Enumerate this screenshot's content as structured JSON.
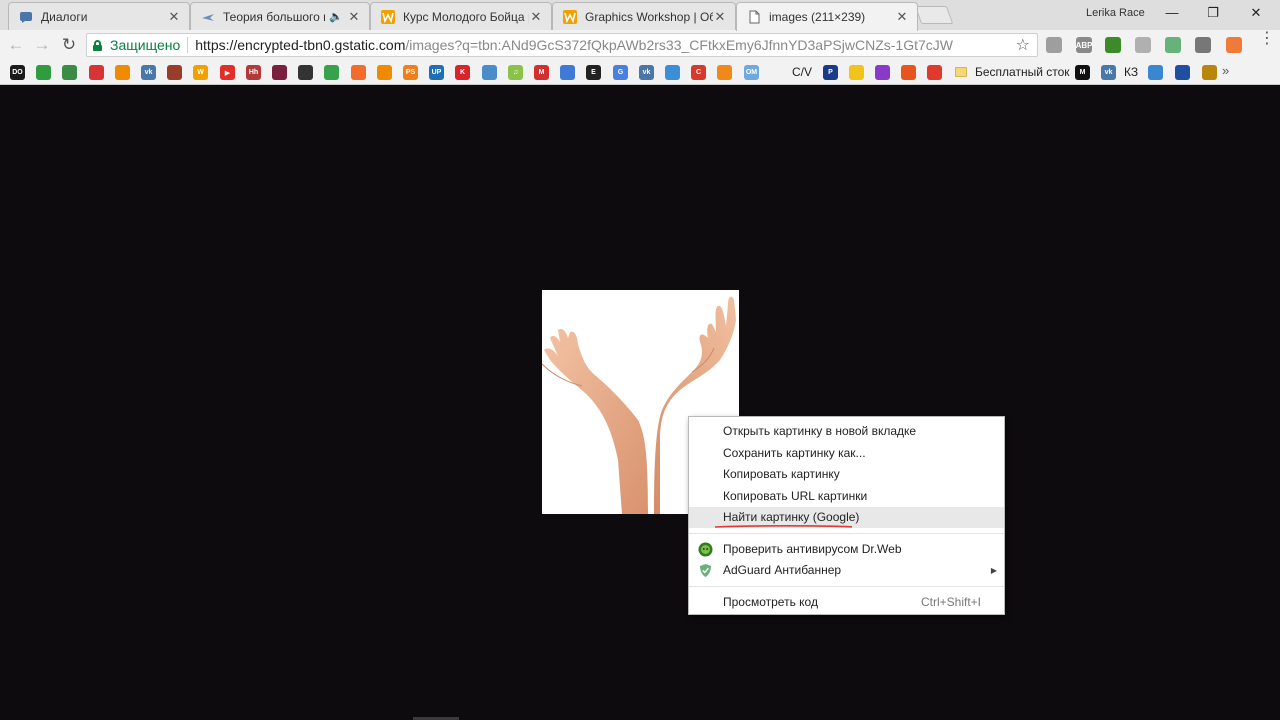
{
  "tabs": [
    {
      "title": "Диалоги",
      "icon": "vk-messages-icon"
    },
    {
      "title": "Теория большого вз",
      "icon": "plane-icon",
      "audio": "🔈"
    },
    {
      "title": "Курс Молодого Бойца |",
      "icon": "w-icon"
    },
    {
      "title": "Graphics Workshop | Об",
      "icon": "w-icon"
    },
    {
      "title": "images (211×239)",
      "icon": "page-icon"
    }
  ],
  "profile_name": "Lerika Race",
  "address": {
    "secure_label": "Защищено",
    "url_host": "https://encrypted-tbn0.gstatic.com",
    "url_path": "/images?q=tbn:ANd9GcS372fQkpAWb2rs33_CFtkxEmy6JfnnYD3aPSjwCNZs-1Gt7cJW"
  },
  "extensions": [
    {
      "name": "extension-icon",
      "label": "",
      "color": "#9e9e9e"
    },
    {
      "name": "adblock-icon",
      "label": "ABP",
      "color": "#8a8a8a"
    },
    {
      "name": "drweb-icon",
      "label": "",
      "color": "#3c8a28"
    },
    {
      "name": "cloud-icon",
      "label": "",
      "color": "#b0b0b0"
    },
    {
      "name": "adguard-icon",
      "label": "",
      "color": "#67b279"
    },
    {
      "name": "dropper-icon",
      "label": "",
      "color": "#777777"
    },
    {
      "name": "photo-icon",
      "label": "",
      "color": "#f07a3a"
    }
  ],
  "bookmarks": {
    "icons": [
      {
        "name": "odnoklassniki-bookmark-icon",
        "label": "DO",
        "color": "#1b1b1b"
      },
      {
        "name": "green-circle-bookmark-icon",
        "label": "",
        "color": "#2e9c3f"
      },
      {
        "name": "turtle-bookmark-icon",
        "label": "",
        "color": "#3a8c46"
      },
      {
        "name": "red-circle-bookmark-icon",
        "label": "",
        "color": "#d93434"
      },
      {
        "name": "orange-square-bookmark-icon",
        "label": "",
        "color": "#f08a00"
      },
      {
        "name": "vk-bookmark-icon",
        "label": "vk",
        "color": "#4a76a8"
      },
      {
        "name": "feather-bookmark-icon",
        "label": "",
        "color": "#9a3c2a"
      },
      {
        "name": "w-bookmark-icon",
        "label": "W",
        "color": "#f0a000"
      },
      {
        "name": "youtube-bookmark-icon",
        "label": "▶",
        "color": "#e52d27"
      },
      {
        "name": "hh-bookmark-icon",
        "label": "Hh",
        "color": "#b33a3a"
      },
      {
        "name": "film-bookmark-icon",
        "label": "",
        "color": "#7a1f3d"
      },
      {
        "name": "shield-bookmark-icon",
        "label": "",
        "color": "#333333"
      },
      {
        "name": "lightning-bookmark-icon",
        "label": "",
        "color": "#36a34a"
      },
      {
        "name": "orange-dot-bookmark-icon",
        "label": "",
        "color": "#f26c2a"
      },
      {
        "name": "reel-bookmark-icon",
        "label": "",
        "color": "#f08a00"
      },
      {
        "name": "ps-bookmark-icon",
        "label": "PS",
        "color": "#f07e1b"
      },
      {
        "name": "up-bookmark-icon",
        "label": "UP",
        "color": "#1f6fb5"
      },
      {
        "name": "k-bookmark-icon",
        "label": "K",
        "color": "#d9252a"
      },
      {
        "name": "bird-bookmark-icon",
        "label": "",
        "color": "#4a8ec9"
      },
      {
        "name": "music-bookmark-icon",
        "label": "♫",
        "color": "#8bc34a"
      },
      {
        "name": "m-red-bookmark-icon",
        "label": "M",
        "color": "#d32f2f"
      },
      {
        "name": "pinwheel-bookmark-icon",
        "label": "",
        "color": "#3f7ad6"
      },
      {
        "name": "e-bookmark-icon",
        "label": "E",
        "color": "#222222"
      },
      {
        "name": "translate-bookmark-icon",
        "label": "G",
        "color": "#4a7fe0"
      },
      {
        "name": "vk2-bookmark-icon",
        "label": "vk",
        "color": "#4a76a8"
      },
      {
        "name": "cloud-blue-bookmark-icon",
        "label": "",
        "color": "#3a8fd6"
      },
      {
        "name": "c-bookmark-icon",
        "label": "C",
        "color": "#d63a2a"
      },
      {
        "name": "flame-bookmark-icon",
        "label": "",
        "color": "#ef8a1a"
      },
      {
        "name": "om-bookmark-icon",
        "label": "ОМ",
        "color": "#6fa8dc"
      }
    ],
    "cv_label": "C/V",
    "icons2": [
      {
        "name": "p-bookmark-icon",
        "label": "P",
        "color": "#1a3a8a"
      },
      {
        "name": "yellow-bookmark-icon",
        "label": "",
        "color": "#f0c419"
      },
      {
        "name": "wheel-bookmark-icon",
        "label": "",
        "color": "#8a3ac9"
      },
      {
        "name": "fox-bookmark-icon",
        "label": "",
        "color": "#e8541d"
      },
      {
        "name": "red-square-bookmark-icon",
        "label": "",
        "color": "#e03a2f"
      }
    ],
    "folder_label": "Бесплатный сток",
    "icons3": [
      {
        "name": "m-black-bookmark-icon",
        "label": "M",
        "color": "#111111"
      },
      {
        "name": "vk3-bookmark-icon",
        "label": "vk",
        "color": "#4a76a8"
      }
    ],
    "k3_label": "КЗ",
    "icons4": [
      {
        "name": "chart-bookmark-icon",
        "label": "",
        "color": "#3a86d0"
      },
      {
        "name": "coin-bookmark-icon",
        "label": "",
        "color": "#1f4fa0"
      },
      {
        "name": "gift-bookmark-icon",
        "label": "",
        "color": "#b8860b"
      }
    ],
    "more": "»"
  },
  "image": {
    "alt": "two hands"
  },
  "context_menu": {
    "items": [
      {
        "label": "Открыть картинку в новой вкладке"
      },
      {
        "label": "Сохранить картинку как..."
      },
      {
        "label": "Копировать картинку"
      },
      {
        "label": "Копировать URL картинки"
      },
      {
        "label": "Найти картинку (Google)"
      }
    ],
    "drweb": "Проверить антивирусом Dr.Web",
    "adguard": "AdGuard Антибаннер",
    "inspect": "Просмотреть код",
    "inspect_shortcut": "Ctrl+Shift+I"
  },
  "colors": {
    "page_bg": "#0e0b0e",
    "underline": "#e53935",
    "secure": "#0b8043"
  }
}
